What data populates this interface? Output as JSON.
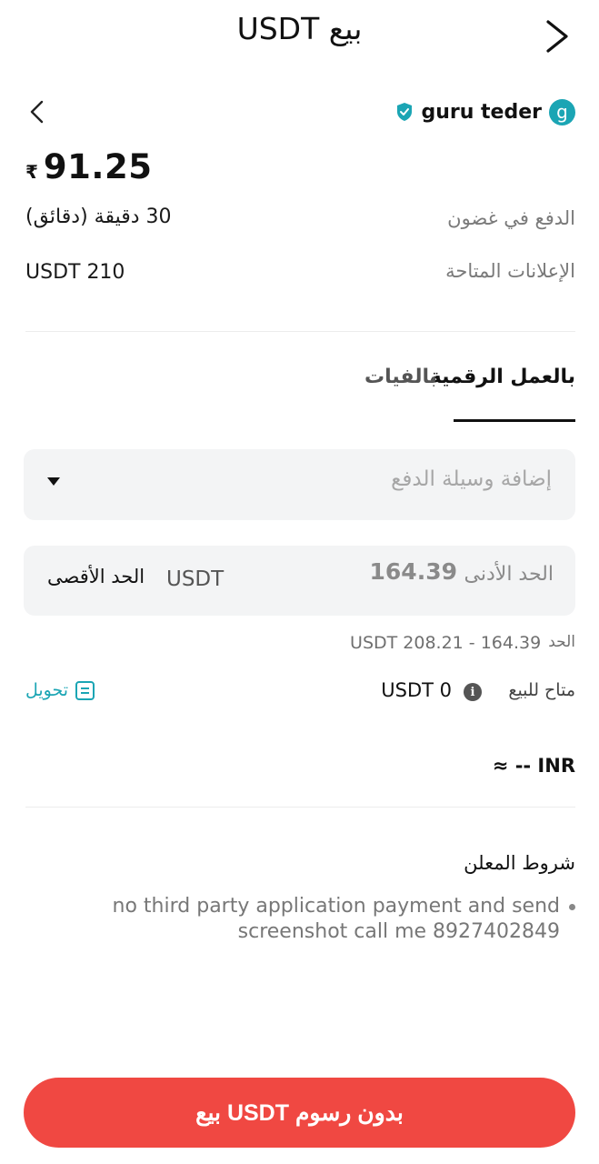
{
  "header": {
    "title": "بيع USDT"
  },
  "merchant": {
    "avatar_letter": "g",
    "name": "guru teder",
    "verified_icon": "shield-check-icon"
  },
  "price": {
    "currency_symbol": "₹",
    "value": "91.25"
  },
  "details": {
    "payment_window_label": "الدفع في غضون",
    "payment_window_value": "30 دقيقة (دقائق)",
    "available_ads_label": "الإعلانات المتاحة",
    "available_ads_value": "USDT 210"
  },
  "tabs": [
    {
      "label": "بالعمل الرقمية",
      "active": true
    },
    {
      "label": "بالفيات",
      "active": false
    }
  ],
  "payment_method": {
    "placeholder": "إضافة وسيلة الدفع"
  },
  "amount": {
    "min_label": "الحد الأدنى",
    "min_value": "164.39",
    "unit": "USDT",
    "max_label": "الحد الأقصى"
  },
  "limit": {
    "label": "الحد",
    "value": "USDT 208.21 - 164.39"
  },
  "available": {
    "label": "متاح للبيع",
    "value": "USDT 0",
    "convert_label": "تحويل"
  },
  "approx": "≈ -- INR",
  "terms": {
    "title": "شروط المعلن",
    "text": "no third party application payment and send screenshot call me 8927402849"
  },
  "sell_button": {
    "label": "بدون رسوم USDT بيع"
  },
  "colors": {
    "accent_teal": "#1ba5b4",
    "sell_red": "#f04842"
  }
}
